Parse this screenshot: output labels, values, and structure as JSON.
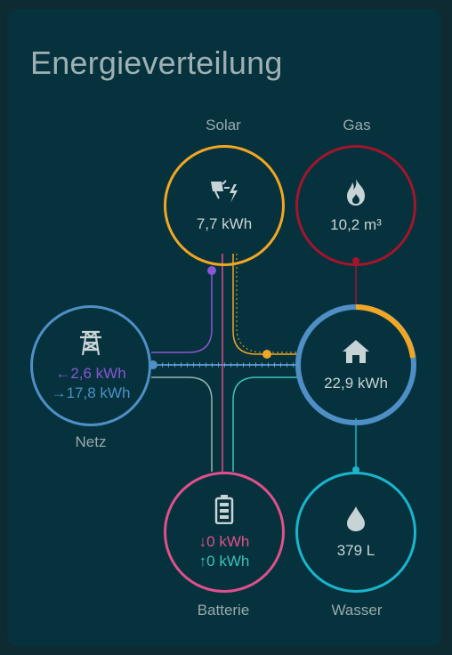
{
  "card": {
    "title": "Energieverteilung"
  },
  "nodes": {
    "solar": {
      "label": "Solar",
      "value": "7,7 kWh",
      "icon": "solar-power-icon",
      "color": "#f3a623"
    },
    "gas": {
      "label": "Gas",
      "value": "10,2 m³",
      "icon": "fire-icon",
      "color": "#a3152b"
    },
    "grid": {
      "label": "Netz",
      "from_grid": "←2,6 kWh",
      "to_grid": "→17,8 kWh",
      "icon": "transmission-tower-icon",
      "color": "#4f8fc6",
      "import_color": "#8b55d6"
    },
    "home": {
      "value": "22,9 kWh",
      "icon": "home-icon",
      "color": "#4f8fc6",
      "solar_share_percent": 28
    },
    "battery": {
      "label": "Batterie",
      "charge": "↓0 kWh",
      "discharge": "↑0 kWh",
      "icon": "battery-icon",
      "color": "#e0508c",
      "discharge_color": "#3ec1b8"
    },
    "water": {
      "label": "Wasser",
      "value": "379 L",
      "icon": "water-drop-icon",
      "color": "#1bb4cc"
    }
  }
}
